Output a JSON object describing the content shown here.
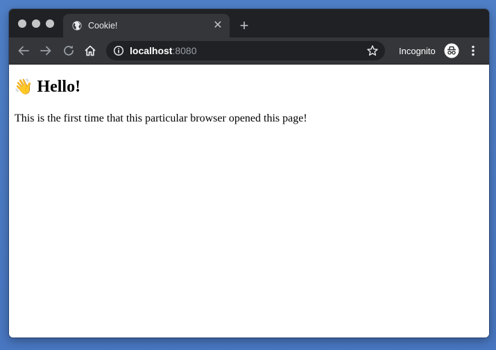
{
  "browser": {
    "tab": {
      "title": "Cookie!",
      "favicon": "globe-icon"
    },
    "address_bar": {
      "host": "localhost",
      "port": ":8080"
    },
    "incognito_label": "Incognito",
    "colors": {
      "frame": "#202124",
      "toolbar": "#35363a",
      "omnibox": "#202124"
    }
  },
  "page": {
    "heading_emoji": "👋",
    "heading": "Hello!",
    "paragraph": "This is the first time that this particular browser opened this page!"
  }
}
